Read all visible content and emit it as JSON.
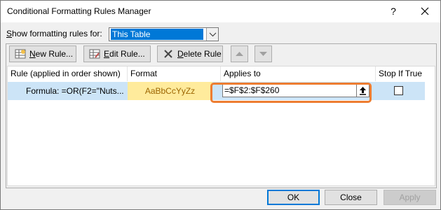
{
  "window": {
    "title": "Conditional Formatting Rules Manager",
    "help_glyph": "?",
    "close_icon": "close-icon"
  },
  "scope": {
    "label": "Show formatting rules for:",
    "selected": "This Table"
  },
  "toolbar": {
    "new_rule": "New Rule...",
    "edit_rule": "Edit Rule...",
    "delete_rule": "Delete Rule"
  },
  "table": {
    "columns": [
      "Rule (applied in order shown)",
      "Format",
      "Applies to",
      "Stop If True"
    ],
    "rows": [
      {
        "rule": "Formula: =OR(F2=\"Nuts...",
        "format_preview": "AaBbCcYyZz",
        "applies_to": "=$F$2:$F$260",
        "stop_if_true": false
      }
    ]
  },
  "footer": {
    "ok": "OK",
    "close": "Close",
    "apply": "Apply"
  },
  "colors": {
    "accent": "#0078d7",
    "highlight": "#ed7d31",
    "format_fill": "#ffeb9c",
    "format_text": "#9c6500",
    "selected_row": "#cce4f7"
  }
}
